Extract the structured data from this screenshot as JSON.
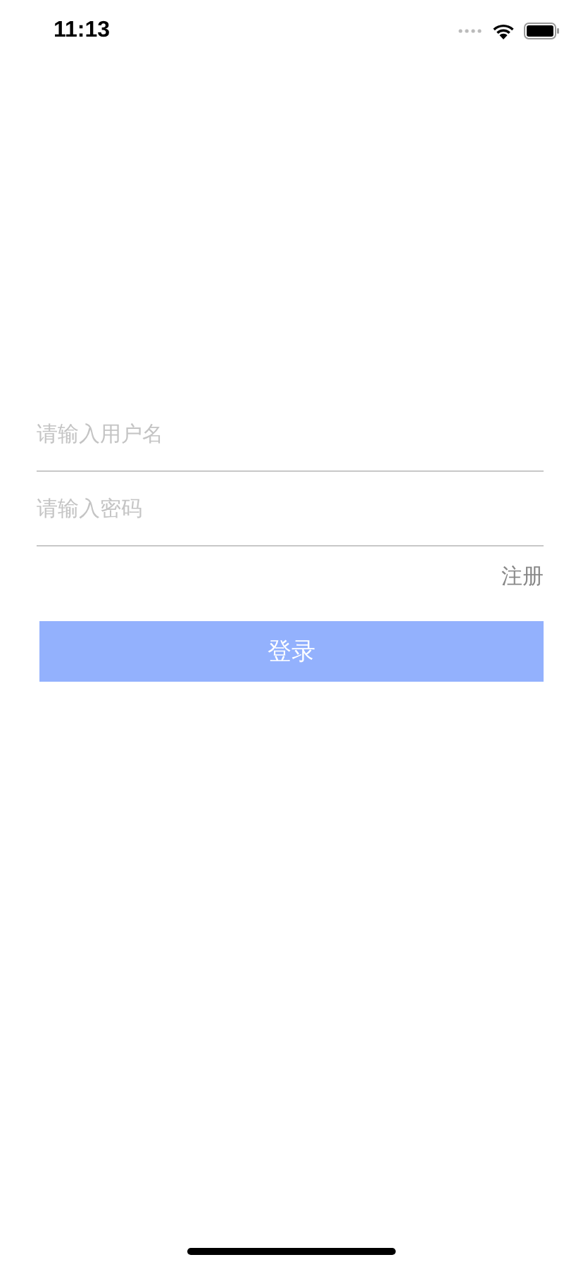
{
  "status_bar": {
    "time": "11:13"
  },
  "fields": [
    {
      "placeholder": "请输入用户名"
    },
    {
      "placeholder": "请输入密码"
    }
  ],
  "register_link": "注册",
  "login_button": "登录"
}
